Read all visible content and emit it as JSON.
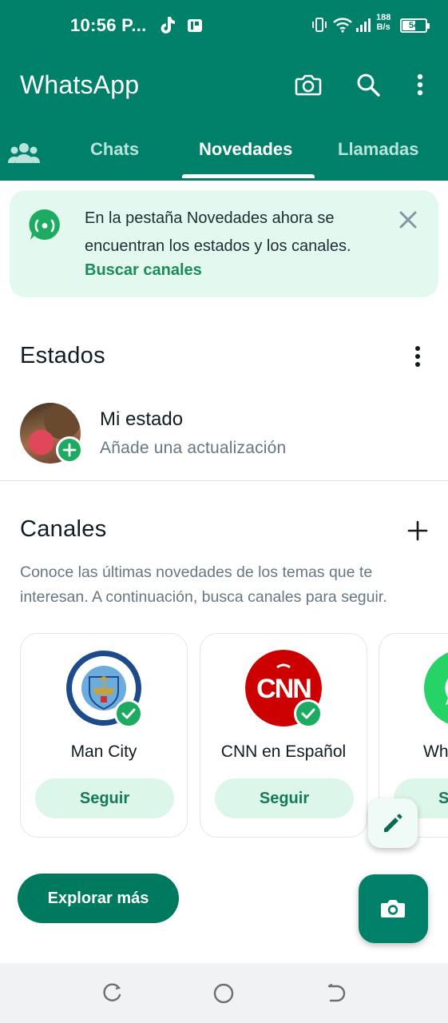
{
  "status_bar": {
    "time": "10:56 P...",
    "net_speed_value": "188",
    "net_speed_unit": "B/s",
    "battery": "54"
  },
  "header": {
    "title": "WhatsApp",
    "camera_icon": "camera-icon",
    "search_icon": "search-icon",
    "menu_icon": "more-vert-icon"
  },
  "tabs": [
    {
      "label": "Chats",
      "active": false
    },
    {
      "label": "Novedades",
      "active": true
    },
    {
      "label": "Llamadas",
      "active": false
    }
  ],
  "banner": {
    "text": "En la pestaña Novedades ahora se encuentran los estados y los canales.",
    "link": "Buscar canales"
  },
  "estados": {
    "title": "Estados",
    "my_status": {
      "name": "Mi estado",
      "subtitle": "Añade una actualización"
    }
  },
  "canales": {
    "title": "Canales",
    "description": "Conoce las últimas novedades de los temas que te interesan. A continuación, busca canales para seguir.",
    "cards": [
      {
        "name": "Man City",
        "follow_label": "Seguir",
        "logo_text": "MANCHESTER CITY"
      },
      {
        "name": "CNN en Español",
        "follow_label": "Seguir",
        "logo_text": "CNN"
      },
      {
        "name": "Wh",
        "follow_label": "S"
      }
    ],
    "explore_label": "Explorar más"
  },
  "colors": {
    "primary": "#008069",
    "accent_green": "#1daa61",
    "banner_bg": "#e3f8ee",
    "follow_bg": "#dcf7ea"
  }
}
